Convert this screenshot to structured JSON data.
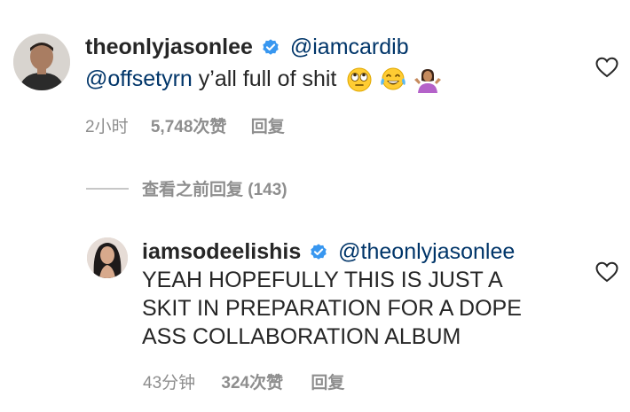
{
  "comment1": {
    "username": "theonlyjasonlee",
    "mention1": "@iamcardib",
    "mention2": "@offsetyrn",
    "text": " y’all full of shit",
    "time": "2小时",
    "likes": "5,748次赞",
    "reply": "回复",
    "emojis": [
      "face-with-rolling-eyes-icon",
      "face-with-tears-of-joy-icon",
      "person-shrugging-icon"
    ]
  },
  "view_replies": "查看之前回复 (143)",
  "comment2": {
    "username": "iamsodeelishis",
    "mention": "@theonlyjasonlee",
    "lines": [
      "YEAH HOPEFULLY THIS IS JUST A",
      "SKIT IN PREPARATION FOR A DOPE",
      "ASS COLLABORATION ALBUM"
    ],
    "time": "43分钟",
    "likes": "324次赞",
    "reply": "回复"
  },
  "colors": {
    "verified": "#3897f0",
    "mention": "#003569",
    "muted": "#8e8e8e",
    "text": "#262626"
  }
}
